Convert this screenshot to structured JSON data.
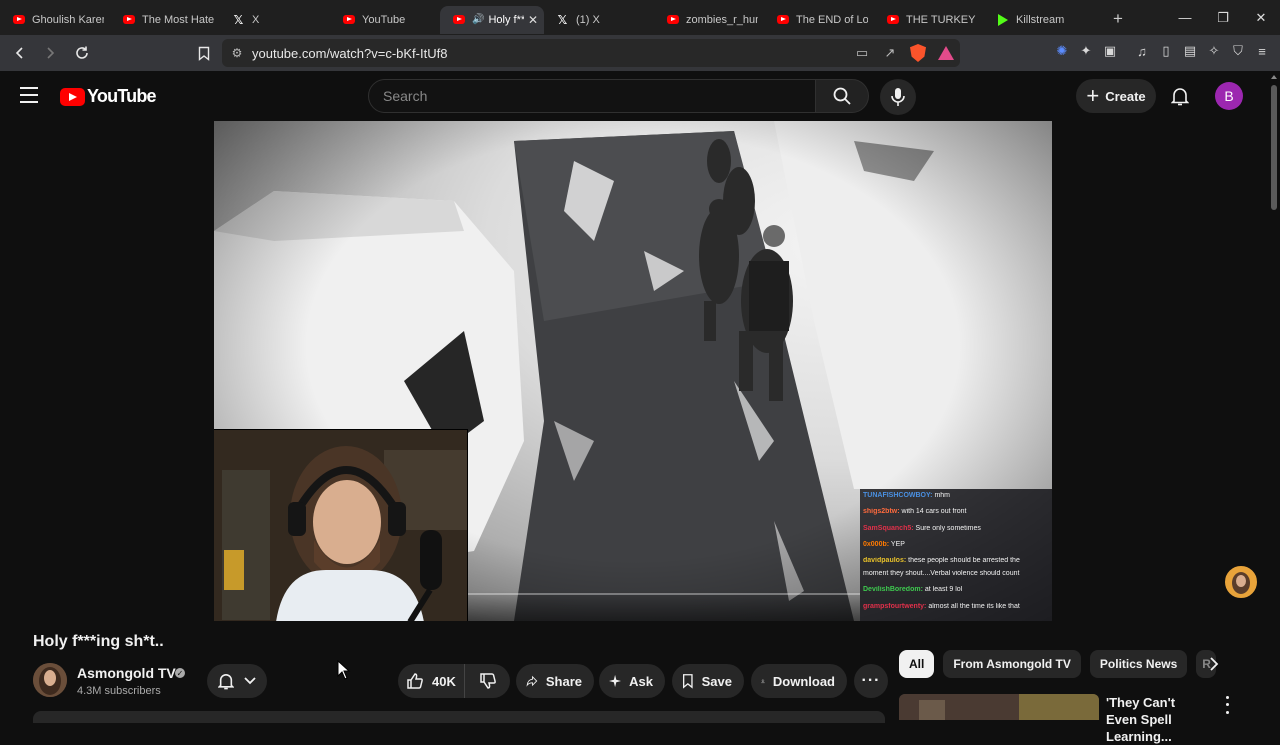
{
  "browser": {
    "tabs": [
      {
        "title": "Ghoulish Karen",
        "icon": "youtube-favicon",
        "active": false
      },
      {
        "title": "The Most Hated",
        "icon": "youtube-favicon",
        "active": false
      },
      {
        "title": "X",
        "icon": "x-favicon",
        "active": false
      },
      {
        "title": "YouTube",
        "icon": "youtube-favicon",
        "active": false
      },
      {
        "title": "Holy f**",
        "icon": "youtube-favicon",
        "active": true
      },
      {
        "title": "(1) X",
        "icon": "x-favicon",
        "active": false
      },
      {
        "title": "zombies_r_hung",
        "icon": "youtube-favicon",
        "active": false
      },
      {
        "title": "The END of Lol",
        "icon": "youtube-favicon",
        "active": false
      },
      {
        "title": "THE TURKEY TC",
        "icon": "youtube-favicon",
        "active": false
      },
      {
        "title": "Killstream",
        "icon": "kick-favicon",
        "active": false
      }
    ],
    "url": "youtube.com/watch?v=c-bKf-ItUf8"
  },
  "youtube": {
    "logo_text": "YouTube",
    "search_placeholder": "Search",
    "create_label": "Create",
    "account_initial": "B",
    "accent_color": "#ff0000",
    "account_color": "#9c27b0"
  },
  "stream_chat": [
    {
      "user": "TUNAFISHCOWBOY:",
      "msg": "mhm",
      "color": "#4a90e2"
    },
    {
      "user": "shigs2btw:",
      "msg": "with 14 cars out front",
      "color": "#ff6a3d"
    },
    {
      "user": "SamSquanch5:",
      "msg": "Sure only sometimes",
      "color": "#e0304a"
    },
    {
      "user": "0x000b:",
      "msg": "YEP",
      "color": "#ff7a00"
    },
    {
      "user": "davidpaulos:",
      "msg": "these people should be arrested the",
      "color": "#e8c12a"
    },
    {
      "user": "",
      "msg": "moment they shout....Verbal violence should count",
      "color": "#f2f2f2"
    },
    {
      "user": "DevilishBoredom:",
      "msg": "at least 9 lol",
      "color": "#3ec94f"
    },
    {
      "user": "grampsfourtwenty:",
      "msg": "almost all the time its like that",
      "color": "#e0304a"
    }
  ],
  "video": {
    "title": "Holy f***ing sh*t..",
    "channel_name": "Asmongold TV",
    "subscribers": "4.3M subscribers",
    "likes": "40K",
    "share_label": "Share",
    "ask_label": "Ask",
    "save_label": "Save",
    "download_label": "Download"
  },
  "chips": [
    "All",
    "From Asmongold TV",
    "Politics News",
    "R"
  ],
  "recommendation": {
    "title": "'They Can't Even Spell Learning..."
  }
}
